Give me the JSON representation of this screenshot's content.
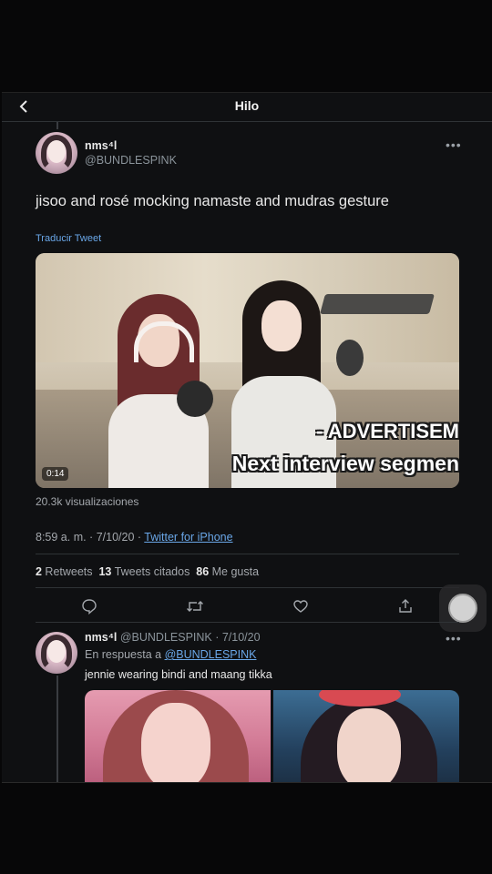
{
  "topbar": {
    "title": "Hilo"
  },
  "tweet": {
    "name": "nms⁴l",
    "handle": "@BUNDLESPINK",
    "text": "jisoo and rosé mocking namaste and mudras gesture",
    "translate_label": "Traducir Tweet",
    "video": {
      "caption_line1": "- ADVERTISEM",
      "caption_line2": "Next interview segmen",
      "duration": "0:14"
    },
    "views": "20.3k visualizaciones",
    "time": "8:59 a. m. · 7/10/20 · ",
    "source": "Twitter for iPhone",
    "stats": {
      "retweets_count": "2",
      "retweets_label": " Retweets  ",
      "quotes_count": "13",
      "quotes_label": " Tweets citados  ",
      "likes_count": "86",
      "likes_label": " Me gusta"
    }
  },
  "reply": {
    "name": "nms⁴l",
    "handle_date": " @BUNDLESPINK · 7/10/20",
    "reply_to_label": "En respuesta a ",
    "reply_to_handle": "@BUNDLESPINK",
    "text": "jennie wearing bindi and maang tikka"
  },
  "colors": {
    "background": "#0f1012",
    "link": "#6aa7e8",
    "muted": "#8b949b"
  },
  "icons": [
    "chevron-left-icon",
    "more-icon",
    "reply-icon",
    "retweet-icon",
    "like-icon",
    "share-icon"
  ]
}
